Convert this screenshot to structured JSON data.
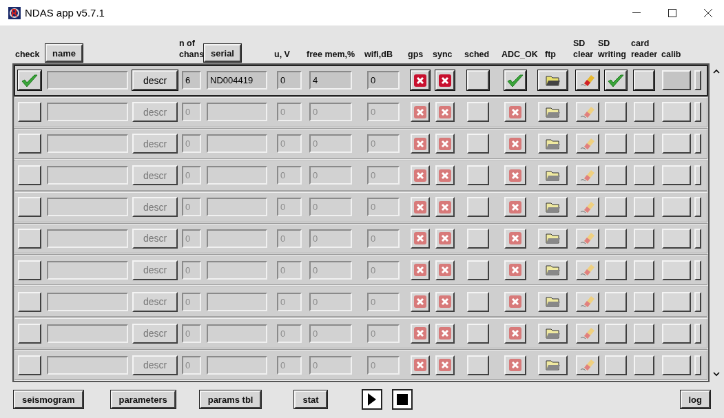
{
  "window": {
    "title": "NDAS app v5.7.1"
  },
  "header": [
    {
      "label": "check",
      "kind": "text"
    },
    {
      "label": "name",
      "kind": "button"
    },
    {
      "label": "n of chans",
      "kind": "text"
    },
    {
      "label": "serial",
      "kind": "button"
    },
    {
      "label": "u, V",
      "kind": "text"
    },
    {
      "label": "free mem,%",
      "kind": "text"
    },
    {
      "label": "wifi,dB",
      "kind": "text"
    },
    {
      "label": "gps",
      "kind": "text"
    },
    {
      "label": "sync",
      "kind": "text"
    },
    {
      "label": "sched",
      "kind": "text"
    },
    {
      "label": "ADC_OK",
      "kind": "text"
    },
    {
      "label": "ftp",
      "kind": "text"
    },
    {
      "label": "SD clear",
      "kind": "text"
    },
    {
      "label": "SD writing",
      "kind": "text"
    },
    {
      "label": "card reader",
      "kind": "text"
    },
    {
      "label": "calib",
      "kind": "text"
    }
  ],
  "rows": [
    {
      "enabled": true,
      "checked": true,
      "descr": "descr",
      "chans": "6",
      "serial": "ND004419",
      "voltage": "0",
      "free_mem": "4",
      "wifi": "0",
      "gps": false,
      "sync": false,
      "adc_ok": true,
      "sd_writing": true
    },
    {
      "enabled": false,
      "checked": false,
      "descr": "descr",
      "chans": "0",
      "voltage": "0",
      "free_mem": "0",
      "wifi": "0",
      "gps": false,
      "sync": false,
      "adc_ok": false,
      "sd_writing": false
    },
    {
      "enabled": false,
      "checked": false,
      "descr": "descr",
      "chans": "0",
      "voltage": "0",
      "free_mem": "0",
      "wifi": "0",
      "gps": false,
      "sync": false,
      "adc_ok": false,
      "sd_writing": false
    },
    {
      "enabled": false,
      "checked": false,
      "descr": "descr",
      "chans": "0",
      "voltage": "0",
      "free_mem": "0",
      "wifi": "0",
      "gps": false,
      "sync": false,
      "adc_ok": false,
      "sd_writing": false
    },
    {
      "enabled": false,
      "checked": false,
      "descr": "descr",
      "chans": "0",
      "voltage": "0",
      "free_mem": "0",
      "wifi": "0",
      "gps": false,
      "sync": false,
      "adc_ok": false,
      "sd_writing": false
    },
    {
      "enabled": false,
      "checked": false,
      "descr": "descr",
      "chans": "0",
      "voltage": "0",
      "free_mem": "0",
      "wifi": "0",
      "gps": false,
      "sync": false,
      "adc_ok": false,
      "sd_writing": false
    },
    {
      "enabled": false,
      "checked": false,
      "descr": "descr",
      "chans": "0",
      "voltage": "0",
      "free_mem": "0",
      "wifi": "0",
      "gps": false,
      "sync": false,
      "adc_ok": false,
      "sd_writing": false
    },
    {
      "enabled": false,
      "checked": false,
      "descr": "descr",
      "chans": "0",
      "voltage": "0",
      "free_mem": "0",
      "wifi": "0",
      "gps": false,
      "sync": false,
      "adc_ok": false,
      "sd_writing": false
    },
    {
      "enabled": false,
      "checked": false,
      "descr": "descr",
      "chans": "0",
      "voltage": "0",
      "free_mem": "0",
      "wifi": "0",
      "gps": false,
      "sync": false,
      "adc_ok": false,
      "sd_writing": false
    },
    {
      "enabled": false,
      "checked": false,
      "descr": "descr",
      "chans": "0",
      "voltage": "0",
      "free_mem": "0",
      "wifi": "0",
      "gps": false,
      "sync": false,
      "adc_ok": false,
      "sd_writing": false
    }
  ],
  "bottom_buttons": [
    {
      "label": "seismogram"
    },
    {
      "label": "parameters"
    },
    {
      "label": "params tbl"
    },
    {
      "label": "stat"
    }
  ],
  "right_button": {
    "label": "log"
  }
}
